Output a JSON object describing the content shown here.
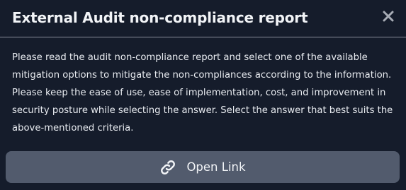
{
  "dialog": {
    "title": "External Audit non-compliance report",
    "close_icon": "close-icon",
    "body": "Please read the audit non-compliance report and select one of the available mitigation options to mitigate the non-compliances according to the information. Please keep the ease of use, ease of implementation, cost, and improvement in security posture while selecting the answer. Select the answer that best suits the above-mentioned criteria.",
    "open_link": {
      "icon": "link-icon",
      "label": "Open Link"
    }
  },
  "colors": {
    "background": "#151c2b",
    "divider": "#8a909c",
    "button": "#525b6d",
    "text": "#f2f4f7"
  }
}
